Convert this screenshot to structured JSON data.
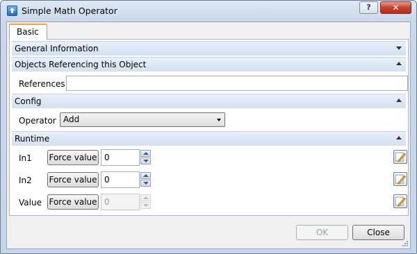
{
  "window": {
    "title": "Simple Math Operator",
    "help_label": "?",
    "close_label": "✕"
  },
  "tabs": [
    {
      "label": "Basic",
      "active": true
    }
  ],
  "sections": {
    "general": {
      "label": "General Information",
      "collapsed": true
    },
    "objects": {
      "label": "Objects Referencing this Object",
      "collapsed": false
    },
    "config": {
      "label": "Config",
      "collapsed": false
    },
    "runtime": {
      "label": "Runtime",
      "collapsed": false
    }
  },
  "references": {
    "label": "References",
    "value": ""
  },
  "config": {
    "operator_label": "Operator",
    "operator_value": "Add"
  },
  "runtime": {
    "rows": [
      {
        "label": "In1",
        "button": "Force value",
        "value": "0",
        "enabled": true
      },
      {
        "label": "In2",
        "button": "Force value",
        "value": "0",
        "enabled": true
      },
      {
        "label": "Value",
        "button": "Force value",
        "value": "0",
        "enabled": false
      }
    ]
  },
  "footer": {
    "ok_label": "OK",
    "ok_enabled": false,
    "close_label": "Close"
  },
  "colors": {
    "tab_accent": "#f5a33b",
    "close_button": "#c7402b",
    "section_header": "#d3e1f2"
  }
}
